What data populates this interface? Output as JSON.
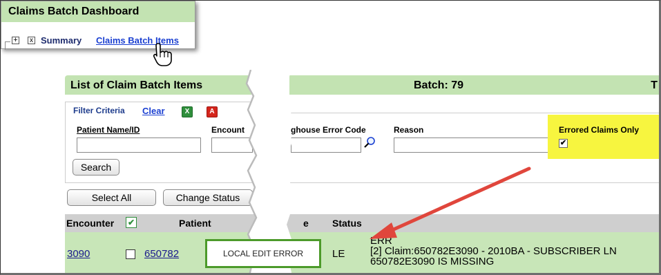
{
  "dashboard": {
    "title": "Claims Batch Dashboard",
    "tree_plus": "+",
    "tree_x": "x",
    "summary_label": "Summary",
    "claims_batch_items_link": "Claims Batch Items"
  },
  "list": {
    "title": "List of Claim Batch Items",
    "batch_label": "Batch: ",
    "batch_number": "79",
    "truncated_right": "T"
  },
  "filter": {
    "legend": "Filter Criteria",
    "clear_label": "Clear",
    "excel_icon": "excel-icon",
    "pdf_icon": "pdf-icon",
    "patient_label": "Patient Name/ID",
    "encounter_label": "Encount",
    "clearinghouse_label": "ghouse Error Code",
    "reason_label": "Reason",
    "errored_only_label": "Errored Claims Only",
    "errored_only_checked": true,
    "patient_value": "",
    "encounter_value": "",
    "clearinghouse_value": "",
    "reason_value": "",
    "search_label": "Search"
  },
  "actions": {
    "select_all_label": "Select All",
    "change_status_label": "Change Status"
  },
  "table": {
    "headers": {
      "encounter": "Encounter",
      "patient": "Patient",
      "partial": "e",
      "status": "Status"
    },
    "rows": [
      {
        "encounter": "3090",
        "patient": "650782",
        "status": "LE",
        "error_lines": [
          "ERR",
          "[2] Claim:650782E3090 - 2010BA - SUBSCRIBER LN",
          "650782E3090 IS MISSING"
        ]
      }
    ]
  },
  "callout": {
    "text": "LOCAL EDIT ERROR"
  },
  "colors": {
    "title_bar": "#c3e3b2",
    "data_row": "#c8e6b8",
    "highlight": "#f7f53f",
    "arrow": "#e0463c",
    "callout_border": "#4c9a2a",
    "link": "#1a3fd1"
  }
}
